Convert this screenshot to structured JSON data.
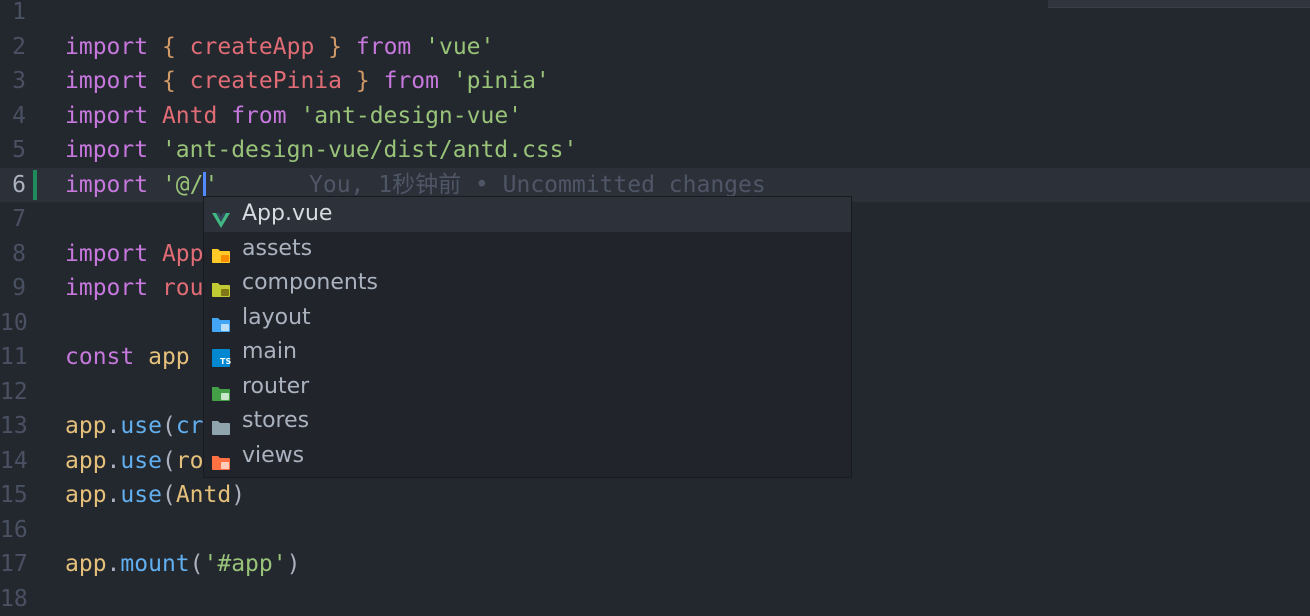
{
  "editor": {
    "lines": [
      {
        "num": "1"
      },
      {
        "num": "2",
        "t": [
          {
            "c": "kw",
            "v": "import"
          },
          {
            "c": "pl",
            "v": " "
          },
          {
            "c": "br",
            "v": "{"
          },
          {
            "c": "pl",
            "v": " "
          },
          {
            "c": "fn",
            "v": "createApp"
          },
          {
            "c": "pl",
            "v": " "
          },
          {
            "c": "br",
            "v": "}"
          },
          {
            "c": "pl",
            "v": " "
          },
          {
            "c": "kw",
            "v": "from"
          },
          {
            "c": "pl",
            "v": " "
          },
          {
            "c": "str",
            "v": "'vue'"
          }
        ]
      },
      {
        "num": "3",
        "t": [
          {
            "c": "kw",
            "v": "import"
          },
          {
            "c": "pl",
            "v": " "
          },
          {
            "c": "br",
            "v": "{"
          },
          {
            "c": "pl",
            "v": " "
          },
          {
            "c": "fn",
            "v": "createPinia"
          },
          {
            "c": "pl",
            "v": " "
          },
          {
            "c": "br",
            "v": "}"
          },
          {
            "c": "pl",
            "v": " "
          },
          {
            "c": "kw",
            "v": "from"
          },
          {
            "c": "pl",
            "v": " "
          },
          {
            "c": "str",
            "v": "'pinia'"
          }
        ]
      },
      {
        "num": "4",
        "t": [
          {
            "c": "kw",
            "v": "import"
          },
          {
            "c": "pl",
            "v": " "
          },
          {
            "c": "fn",
            "v": "Antd"
          },
          {
            "c": "pl",
            "v": " "
          },
          {
            "c": "kw",
            "v": "from"
          },
          {
            "c": "pl",
            "v": " "
          },
          {
            "c": "str",
            "v": "'ant-design-vue'"
          }
        ]
      },
      {
        "num": "5",
        "t": [
          {
            "c": "kw",
            "v": "import"
          },
          {
            "c": "pl",
            "v": " "
          },
          {
            "c": "str",
            "v": "'ant-design-vue/dist/antd.css'"
          }
        ]
      },
      {
        "num": "6",
        "current": true,
        "git": true,
        "t": [
          {
            "c": "kw",
            "v": "import"
          },
          {
            "c": "pl",
            "v": " "
          },
          {
            "c": "str",
            "v": "'@/"
          },
          {
            "cursor": true
          },
          {
            "c": "str",
            "v": "'"
          }
        ]
      },
      {
        "num": "7"
      },
      {
        "num": "8",
        "t": [
          {
            "c": "kw",
            "v": "import"
          },
          {
            "c": "pl",
            "v": " "
          },
          {
            "c": "fn",
            "v": "App"
          }
        ]
      },
      {
        "num": "9",
        "t": [
          {
            "c": "kw",
            "v": "import"
          },
          {
            "c": "pl",
            "v": " "
          },
          {
            "c": "fn",
            "v": "rou"
          }
        ]
      },
      {
        "num": "10"
      },
      {
        "num": "11",
        "t": [
          {
            "c": "kw",
            "v": "const"
          },
          {
            "c": "pl",
            "v": " "
          },
          {
            "c": "var",
            "v": "app"
          }
        ]
      },
      {
        "num": "12"
      },
      {
        "num": "13",
        "t": [
          {
            "c": "var",
            "v": "app"
          },
          {
            "c": "pn",
            "v": "."
          },
          {
            "c": "mth",
            "v": "use"
          },
          {
            "c": "pn",
            "v": "("
          },
          {
            "c": "mth",
            "v": "cr"
          }
        ]
      },
      {
        "num": "14",
        "t": [
          {
            "c": "var",
            "v": "app"
          },
          {
            "c": "pn",
            "v": "."
          },
          {
            "c": "mth",
            "v": "use"
          },
          {
            "c": "pn",
            "v": "("
          },
          {
            "c": "var",
            "v": "ro"
          }
        ]
      },
      {
        "num": "15",
        "t": [
          {
            "c": "var",
            "v": "app"
          },
          {
            "c": "pn",
            "v": "."
          },
          {
            "c": "mth",
            "v": "use"
          },
          {
            "c": "pn",
            "v": "("
          },
          {
            "c": "var",
            "v": "Antd"
          },
          {
            "c": "pn",
            "v": ")"
          }
        ]
      },
      {
        "num": "16"
      },
      {
        "num": "17",
        "t": [
          {
            "c": "var",
            "v": "app"
          },
          {
            "c": "pn",
            "v": "."
          },
          {
            "c": "mth",
            "v": "mount"
          },
          {
            "c": "pn",
            "v": "("
          },
          {
            "c": "str",
            "v": "'#app'"
          },
          {
            "c": "pn",
            "v": ")"
          }
        ]
      },
      {
        "num": "18"
      }
    ],
    "blame": "You, 1秒钟前 • Uncommitted changes"
  },
  "suggestions": [
    {
      "label": "App.vue",
      "icon": "vue-icon",
      "selected": true
    },
    {
      "label": "assets",
      "icon": "folder-assets-icon"
    },
    {
      "label": "components",
      "icon": "folder-components-icon"
    },
    {
      "label": "layout",
      "icon": "folder-layout-icon"
    },
    {
      "label": "main",
      "icon": "typescript-file-icon"
    },
    {
      "label": "router",
      "icon": "folder-router-icon"
    },
    {
      "label": "stores",
      "icon": "folder-icon"
    },
    {
      "label": "views",
      "icon": "folder-views-icon"
    }
  ],
  "colors": {
    "background": "#23272e",
    "current_line": "#2b3039",
    "keyword": "#c678dd",
    "identifier": "#e06c75",
    "string": "#98c379",
    "variable": "#e5c07b",
    "method": "#61afef",
    "git_added": "#1f8a5c"
  }
}
